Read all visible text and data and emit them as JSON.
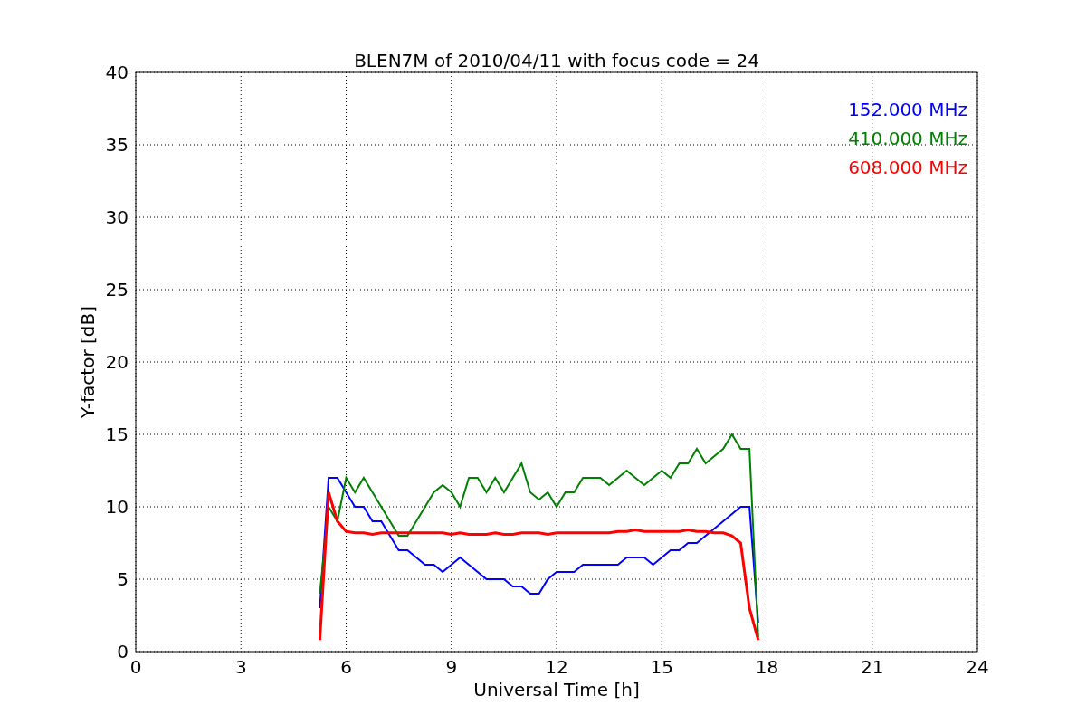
{
  "chart_data": {
    "type": "line",
    "title": "BLEN7M of 2010/04/11 with focus code = 24",
    "xlabel": "Universal Time [h]",
    "ylabel": "Y-factor [dB]",
    "x": [
      5.25,
      5.5,
      5.75,
      6,
      6.25,
      6.5,
      6.75,
      7,
      7.25,
      7.5,
      7.75,
      8,
      8.25,
      8.5,
      8.75,
      9,
      9.25,
      9.5,
      9.75,
      10,
      10.25,
      10.5,
      10.75,
      11,
      11.25,
      11.5,
      11.75,
      12,
      12.25,
      12.5,
      12.75,
      13,
      13.25,
      13.5,
      13.75,
      14,
      14.25,
      14.5,
      14.75,
      15,
      15.25,
      15.5,
      15.75,
      16,
      16.25,
      16.5,
      16.75,
      17,
      17.25,
      17.5,
      17.75
    ],
    "series": [
      {
        "name": "152.000 MHz",
        "color": "#0000ff",
        "values": [
          3,
          12,
          12,
          11,
          10,
          10,
          9,
          9,
          8,
          7,
          7,
          6.5,
          6,
          6,
          5.5,
          6,
          6.5,
          6,
          5.5,
          5,
          5,
          5,
          4.5,
          4.5,
          4,
          4,
          5,
          5.5,
          5.5,
          5.5,
          6,
          6,
          6,
          6,
          6,
          6.5,
          6.5,
          6.5,
          6,
          6.5,
          7,
          7,
          7.5,
          7.5,
          8,
          8.5,
          9,
          9.5,
          10,
          10,
          2
        ]
      },
      {
        "name": "410.000 MHz",
        "color": "#008000",
        "values": [
          4,
          10,
          9,
          12,
          11,
          12,
          11,
          10,
          9,
          8,
          8,
          9,
          10,
          11,
          11.5,
          11,
          10,
          12,
          12,
          11,
          12,
          11,
          12,
          13,
          11,
          10.5,
          11,
          10,
          11,
          11,
          12,
          12,
          12,
          11.5,
          12,
          12.5,
          12,
          11.5,
          12,
          12.5,
          12,
          13,
          13,
          14,
          13,
          13.5,
          14,
          15,
          14,
          14,
          1
        ]
      },
      {
        "name": "608.000 MHz",
        "color": "#ff0000",
        "values": [
          0.8,
          11,
          9,
          8.3,
          8.2,
          8.2,
          8.1,
          8.2,
          8.2,
          8.2,
          8.2,
          8.2,
          8.2,
          8.2,
          8.2,
          8.1,
          8.2,
          8.1,
          8.1,
          8.1,
          8.2,
          8.1,
          8.1,
          8.2,
          8.2,
          8.2,
          8.1,
          8.2,
          8.2,
          8.2,
          8.2,
          8.2,
          8.2,
          8.2,
          8.3,
          8.3,
          8.4,
          8.3,
          8.3,
          8.3,
          8.3,
          8.3,
          8.4,
          8.3,
          8.3,
          8.2,
          8.2,
          8,
          7.5,
          3,
          0.8
        ]
      }
    ],
    "grid": true,
    "xlim": [
      0,
      24
    ],
    "ylim": [
      0,
      40
    ],
    "xticks": [
      0,
      3,
      6,
      9,
      12,
      15,
      18,
      21,
      24
    ],
    "yticks": [
      0,
      5,
      10,
      15,
      20,
      25,
      30,
      35,
      40
    ]
  }
}
